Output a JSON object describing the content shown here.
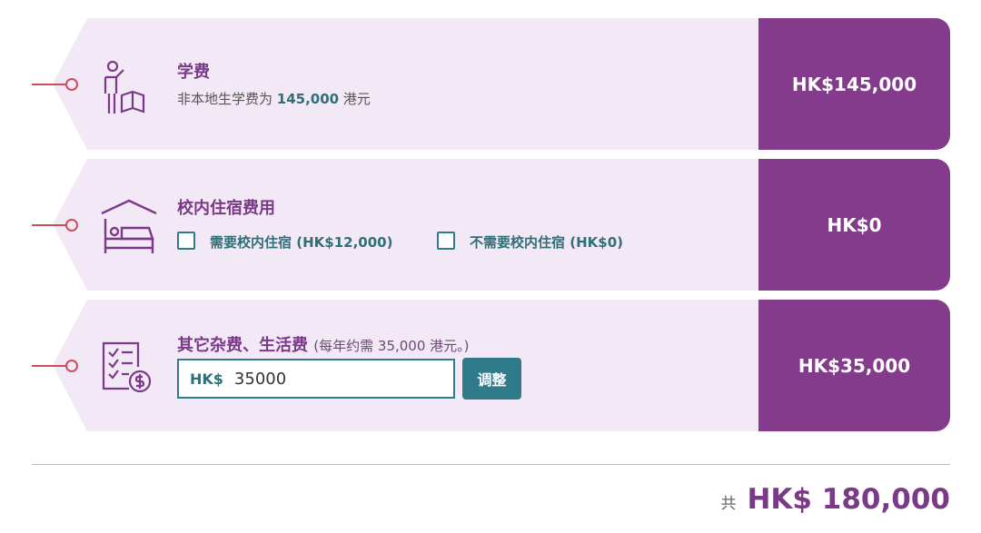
{
  "tuition": {
    "title": "学费",
    "subtitle_prefix": "非本地生学费为",
    "subtitle_amount": "145,000",
    "subtitle_suffix": "港元",
    "price": "HK$145,000",
    "icon": "teacher-icon"
  },
  "housing": {
    "title": "校内住宿费用",
    "option1_label": "需要校内住宿 (HK$12,000)",
    "option1_checked": false,
    "option2_label": "不需要校内住宿 (HK$0)",
    "option2_checked": false,
    "price": "HK$0",
    "icon": "bed-icon"
  },
  "living": {
    "title": "其它杂费、生活费",
    "note": "(每年约需 35,000 港元。)",
    "input_prefix": "HK$",
    "input_value": "35000",
    "adjust_button": "调整",
    "price": "HK$35,000",
    "icon": "checklist-money-icon"
  },
  "total": {
    "prefix": "共",
    "amount": "HK$ 180,000"
  },
  "colors": {
    "card_bg": "#f3e8f5",
    "price_bg": "#843b8b",
    "accent_teal": "#2f7b8a",
    "connector": "#c9505b",
    "title_purple": "#7a3a88"
  }
}
